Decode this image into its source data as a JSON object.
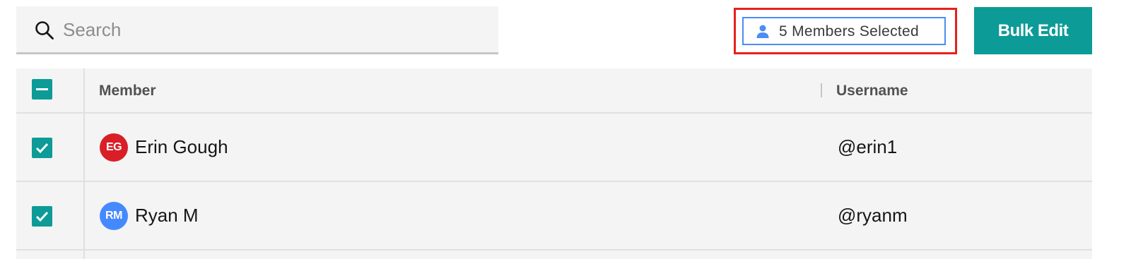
{
  "search": {
    "placeholder": "Search",
    "value": "",
    "icon": "search-icon"
  },
  "selection": {
    "label": "5 Members Selected",
    "icon": "person-icon",
    "badge_color": "#4b8cf5",
    "highlight_color": "#e5211d"
  },
  "toolbar": {
    "bulk_edit_label": "Bulk Edit",
    "accent_color": "#0d9b97"
  },
  "table": {
    "header_checkbox_state": "indeterminate",
    "columns": [
      "Member",
      "Username"
    ],
    "rows": [
      {
        "checked": true,
        "initials": "EG",
        "avatar_color": "#da1e28",
        "name": "Erin Gough",
        "username": "@erin1"
      },
      {
        "checked": true,
        "initials": "RM",
        "avatar_color": "#4589ff",
        "name": "Ryan M",
        "username": "@ryanm"
      }
    ]
  }
}
